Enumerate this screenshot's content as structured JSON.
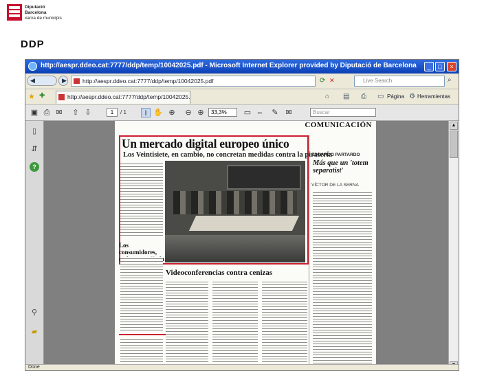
{
  "slide": {
    "logo_line1": "Diputació",
    "logo_line2": "Barcelona",
    "logo_line3": "xarxa de municipis",
    "title": "DDP"
  },
  "browser": {
    "window_title": "http://aespr.ddeo.cat:7777/ddp/temp/10042025.pdf - Microsoft Internet Explorer provided by Diputació de Barcelona",
    "minimize": "_",
    "maximize": "□",
    "close": "×",
    "back_label": "◀",
    "forward_label": "▶",
    "url": "http://aespr.ddeo.cat:7777/ddp/temp/10042025.pdf",
    "search_placeholder": "Live Search",
    "tab_title": "http://aespr.ddeo.cat:7777/ddp/temp/10042025.pdf",
    "tools_page_label": "Página",
    "tools_label": "Herramientas",
    "status_text": "Done"
  },
  "pdf_toolbar": {
    "page_current": "1",
    "page_total": "/ 1",
    "zoom": "33,3%",
    "find_placeholder": "Buscar"
  },
  "newspaper": {
    "section": "COMUNICACIÓN",
    "headline": "Un mercado digital europeo único",
    "subhead": "Los Veintisiete, en cambio, no concretan medidas contra la piratería",
    "sidebar_title": "Los consumidores, en la encrucijada",
    "caption_title": "Videoconferencias contra cenizas",
    "right_kicker": "EDUARDO PARTARDO",
    "right_title": "Más que un 'totem separatist'",
    "right_author": "VÍCTOR DE LA SERNA"
  }
}
